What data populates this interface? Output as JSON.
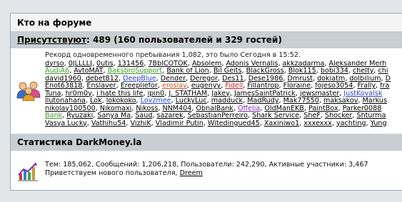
{
  "header": {
    "title": "Кто на форуме"
  },
  "online": {
    "label": "Присутствуют",
    "summary": ": 489 (160 пользователей и 329 гостей)",
    "record": "Рекорд одновременного пребывания 1,082, это было Сегодня в 15:52.",
    "lines": [
      [
        {
          "t": "dyrso",
          "c": ""
        },
        {
          "t": "0JLLLLJ",
          "c": ""
        },
        {
          "t": "0utis",
          "c": ""
        },
        {
          "t": "131456",
          "c": ""
        },
        {
          "t": "7BblCOTOK",
          "c": ""
        },
        {
          "t": "Absolem",
          "c": ""
        },
        {
          "t": "Adonis Vernalis",
          "c": ""
        },
        {
          "t": "akkzadarma",
          "c": ""
        },
        {
          "t": "Aleksander Merh",
          "c": ""
        }
      ],
      [
        {
          "t": "AudiA6",
          "c": "green"
        },
        {
          "t": "AvtoMAT",
          "c": ""
        },
        {
          "t": "BaksbroSupport",
          "c": "green"
        },
        {
          "t": "Bank of Lion",
          "c": ""
        },
        {
          "t": "Bil Geits",
          "c": ""
        },
        {
          "t": "BlackGross",
          "c": ""
        },
        {
          "t": "Blok115",
          "c": ""
        },
        {
          "t": "bobi334",
          "c": ""
        },
        {
          "t": "chelty",
          "c": ""
        },
        {
          "t": "chi",
          "c": ""
        }
      ],
      [
        {
          "t": "david1960",
          "c": ""
        },
        {
          "t": "debet812",
          "c": ""
        },
        {
          "t": "DeepBlue",
          "c": "blue"
        },
        {
          "t": "Dender",
          "c": ""
        },
        {
          "t": "Deregor",
          "c": ""
        },
        {
          "t": "Des11",
          "c": ""
        },
        {
          "t": "Dese1986",
          "c": ""
        },
        {
          "t": "Dmrust",
          "c": ""
        },
        {
          "t": "dokiatm",
          "c": ""
        },
        {
          "t": "dolbilium",
          "c": ""
        },
        {
          "t": "D",
          "c": ""
        }
      ],
      [
        {
          "t": "Enot63818",
          "c": ""
        },
        {
          "t": "Enslaver",
          "c": ""
        },
        {
          "t": "Ereepliefor",
          "c": ""
        },
        {
          "t": "eroslav",
          "c": "orange"
        },
        {
          "t": "eugenyy",
          "c": ""
        },
        {
          "t": "Fidell",
          "c": "red"
        },
        {
          "t": "Fillantrop",
          "c": ""
        },
        {
          "t": "Floraine",
          "c": ""
        },
        {
          "t": "fojeso3054",
          "c": ""
        },
        {
          "t": "Frally",
          "c": ""
        },
        {
          "t": "fra",
          "c": ""
        }
      ],
      [
        {
          "t": "Tuna",
          "c": ""
        },
        {
          "t": "hr0m0y",
          "c": ""
        },
        {
          "t": "i hate this life",
          "c": ""
        },
        {
          "t": "ipin0",
          "c": ""
        },
        {
          "t": "J. STATHAM",
          "c": ""
        },
        {
          "t": "Jakey",
          "c": ""
        },
        {
          "t": "JamesSaintPatrick",
          "c": ""
        },
        {
          "t": "jewsmaster",
          "c": ""
        },
        {
          "t": "JustKovalsk",
          "c": "blue"
        }
      ],
      [
        {
          "t": "llutonahana",
          "c": ""
        },
        {
          "t": "Lok",
          "c": ""
        },
        {
          "t": "lokokoko",
          "c": ""
        },
        {
          "t": "Lovzmee",
          "c": "blue"
        },
        {
          "t": "LuckyLuc",
          "c": ""
        },
        {
          "t": "madduck",
          "c": ""
        },
        {
          "t": "MadRudy",
          "c": ""
        },
        {
          "t": "Mak77550",
          "c": ""
        },
        {
          "t": "maksakov",
          "c": ""
        },
        {
          "t": "Markus",
          "c": ""
        }
      ],
      [
        {
          "t": "nikolay100500",
          "c": ""
        },
        {
          "t": "Nikomaxi",
          "c": ""
        },
        {
          "t": "Nikoss",
          "c": ""
        },
        {
          "t": "NNM404",
          "c": ""
        },
        {
          "t": "ObnalBank",
          "c": ""
        },
        {
          "t": "Offelia",
          "c": "purple"
        },
        {
          "t": "OldManEKB",
          "c": ""
        },
        {
          "t": "PaintBox",
          "c": ""
        },
        {
          "t": "Parker0088",
          "c": ""
        },
        {
          "t": "",
          "c": ""
        }
      ],
      [
        {
          "t": "Bank",
          "c": "green"
        },
        {
          "t": "Ryuzaki",
          "c": ""
        },
        {
          "t": "Sanya Ma",
          "c": ""
        },
        {
          "t": "Saud",
          "c": ""
        },
        {
          "t": "sazarek",
          "c": ""
        },
        {
          "t": "SebastianPerreiro",
          "c": ""
        },
        {
          "t": "Shark Service",
          "c": ""
        },
        {
          "t": "SheF",
          "c": ""
        },
        {
          "t": "Shocker",
          "c": ""
        },
        {
          "t": "Shturma",
          "c": ""
        }
      ],
      [
        {
          "t": "Vasya Lucky",
          "c": ""
        },
        {
          "t": "Vathihu54",
          "c": ""
        },
        {
          "t": "VizhiK",
          "c": ""
        },
        {
          "t": "Vladimir Putin",
          "c": ""
        },
        {
          "t": "Witedingued45",
          "c": ""
        },
        {
          "t": "Xaxiniwo1",
          "c": ""
        },
        {
          "t": "xxxexxx",
          "c": ""
        },
        {
          "t": "yachting",
          "c": ""
        },
        {
          "t": "Yung",
          "c": ""
        }
      ]
    ]
  },
  "stats": {
    "title": "Статистика DarkMoney.la",
    "line1": "Тем: 185,062, Сообщений: 1,206,218, Пользователи: 242,290, Активные участники: 3,467",
    "welcome_prefix": "Приветствуем нового пользователя, ",
    "newest_user": "Dreem"
  }
}
